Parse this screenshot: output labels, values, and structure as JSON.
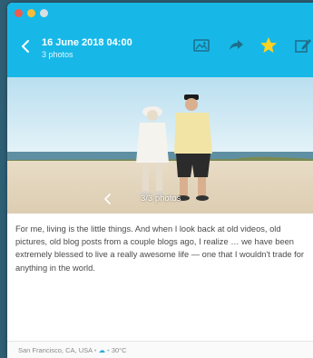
{
  "window": {
    "controls": [
      "close",
      "minimize",
      "maximize"
    ]
  },
  "toolbar": {
    "back_icon": "chevron-left-icon",
    "date": "16 June 2018 04:00",
    "photo_count": "3 photos",
    "icons": [
      "photo-icon",
      "share-icon",
      "star-icon",
      "edit-icon"
    ],
    "accent": "#17b8e8",
    "star_color": "#ffd21f"
  },
  "photo": {
    "counter": "3/3 photos",
    "nav_icon": "chevron-left-icon"
  },
  "entry": {
    "text": "For me, living is the little things. And when I look back at old videos, old pictures, old blog posts from a couple blogs ago, I realize … we have been extremely blessed to live a really awesome life — one that I wouldn't trade for anything in the world."
  },
  "footer": {
    "location": "San Francisco, CA, USA",
    "weather_icon": "weather-icon",
    "temperature": "30°C"
  }
}
